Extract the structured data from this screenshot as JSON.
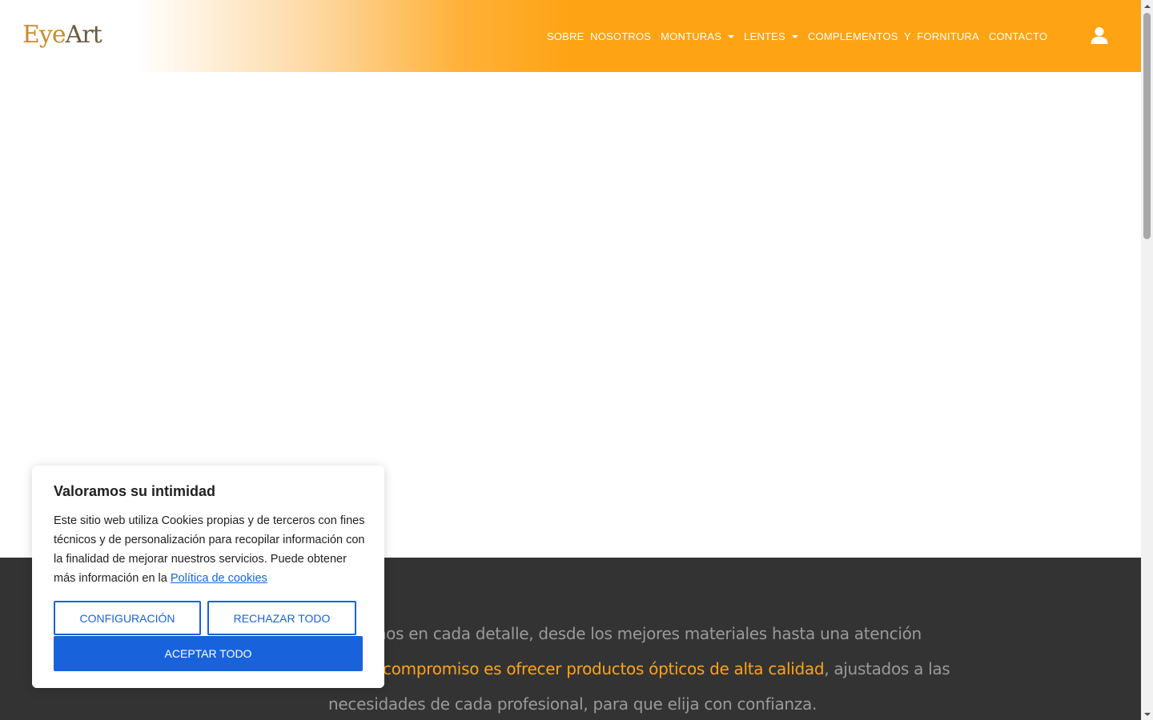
{
  "header": {
    "logo_eye": "Eye",
    "logo_art": "Art",
    "nav": [
      {
        "label": "SOBRE  NOSOTROS",
        "has_dropdown": false
      },
      {
        "label": "MONTURAS",
        "has_dropdown": true
      },
      {
        "label": "LENTES",
        "has_dropdown": true
      },
      {
        "label": "COMPLEMENTOS  Y  FORNITURA",
        "has_dropdown": false
      },
      {
        "label": "CONTACTO",
        "has_dropdown": false
      }
    ],
    "user_icon": "user-icon"
  },
  "mission": {
    "line1": "mos en cada detalle, desde los mejores materiales hasta una atención",
    "highlight": "compromiso es ofrecer productos ópticos de alta calidad",
    "line2_rest": ", ajustados a las",
    "line3": "necesidades de cada profesional, para que elija con confianza."
  },
  "cookie": {
    "title": "Valoramos su intimidad",
    "text": "Este sitio web utiliza Cookies propias y de terceros con fines técnicos y de personalización para recopilar información con la finalidad de mejorar nuestros servicios. Puede obtener más información en la ",
    "link": "Política de cookies",
    "config_label": "CONFIGURACIÓN",
    "reject_label": "RECHAZAR TODO",
    "accept_label": "ACEPTAR TODO"
  },
  "colors": {
    "brand_orange": "#fea314",
    "accept_blue": "#1863dc",
    "dark_section": "#333333"
  }
}
